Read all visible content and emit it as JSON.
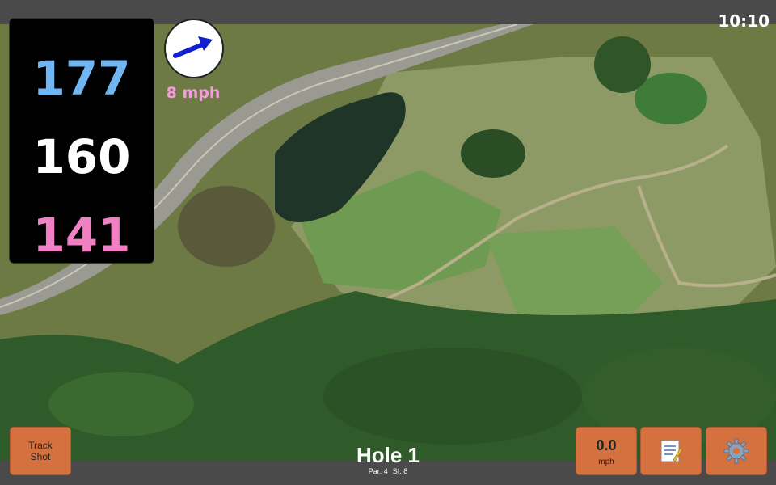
{
  "status_bar": {
    "time": "10:10"
  },
  "distances": {
    "back": "177",
    "middle": "160",
    "front": "141"
  },
  "wind": {
    "speed": "8 mph",
    "direction_icon": "arrow-right-icon"
  },
  "buttons": {
    "track_shot": {
      "line1": "Track",
      "line2": "Shot"
    },
    "speed": {
      "value": "0.0",
      "unit": "mph"
    },
    "notes_icon": "memo-icon",
    "settings_icon": "gear-icon"
  },
  "hole": {
    "title": "Hole 1",
    "par": "Par: 4",
    "si": "SI: 8"
  },
  "colors": {
    "button": "#d5713f",
    "back": "#6fb6f3",
    "front": "#f07fc4",
    "wind_text": "#f59be0"
  }
}
